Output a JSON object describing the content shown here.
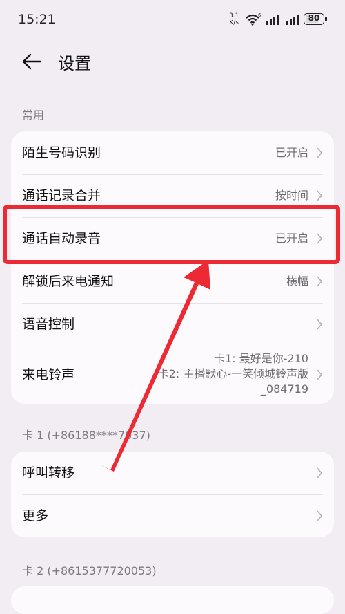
{
  "status_bar": {
    "time": "15:21",
    "net_speed_value": "3.1",
    "net_speed_unit": "K/s",
    "wifi_badge": "6",
    "battery": "80",
    "battery_level": 0.8,
    "icons": [
      "wifi-icon",
      "signal-icon",
      "signal-icon",
      "battery-icon"
    ]
  },
  "header": {
    "title": "设置",
    "back_icon": "back-arrow-icon"
  },
  "sections": {
    "common": {
      "title": "常用",
      "rows": [
        {
          "label": "陌生号码识别",
          "value": "已开启"
        },
        {
          "label": "通话记录合并",
          "value": "按时间"
        },
        {
          "label": "通话自动录音",
          "value": "已开启"
        },
        {
          "label": "解锁后来电通知",
          "value": "横幅"
        },
        {
          "label": "语音控制",
          "value": ""
        },
        {
          "label": "来电铃声",
          "values": [
            "卡1: 最好是你-210",
            "卡2: 主播默心-一笑倾城铃声版",
            "_084719"
          ]
        }
      ]
    },
    "card1": {
      "title": "卡 1 (+86188****7037)",
      "rows": [
        {
          "label": "呼叫转移"
        },
        {
          "label": "更多"
        }
      ]
    },
    "card2": {
      "title": "卡 2 (+8615377720053)"
    }
  },
  "annotation": {
    "highlight_color": "#ec2a33"
  }
}
